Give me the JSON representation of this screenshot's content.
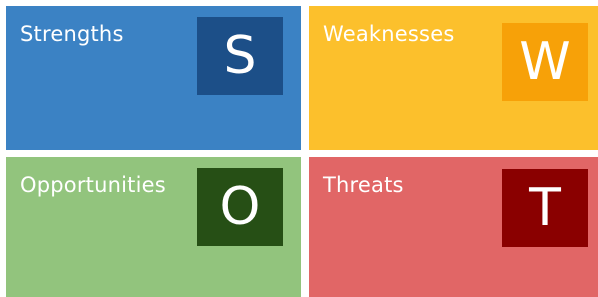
{
  "quadrants": [
    {
      "id": "strengths",
      "title": "Strengths",
      "letter": "S",
      "bg": "#3b82c4",
      "box": "#1c4f88"
    },
    {
      "id": "weaknesses",
      "title": "Weaknesses",
      "letter": "W",
      "bg": "#fcc02c",
      "box": "#f7a108"
    },
    {
      "id": "opportunities",
      "title": "Opportunities",
      "letter": "O",
      "bg": "#92c47d",
      "box": "#264f15"
    },
    {
      "id": "threats",
      "title": "Threats",
      "letter": "T",
      "bg": "#e16666",
      "box": "#8a0000"
    }
  ]
}
